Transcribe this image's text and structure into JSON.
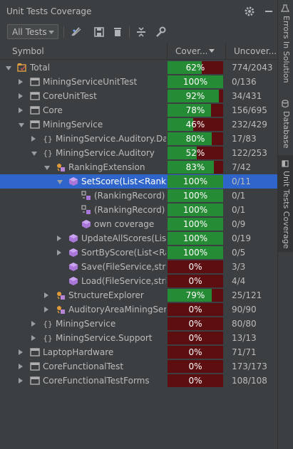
{
  "panel": {
    "title": "Unit Tests Coverage",
    "header_icons": [
      "gear-icon",
      "minimize-icon"
    ]
  },
  "toolbar": {
    "filter_value": "All Tests",
    "icons": [
      "show-covering-tests-icon",
      "export-icon",
      "delete-icon",
      "collapse-all-icon",
      "settings-wrench-icon"
    ]
  },
  "columns": {
    "symbol": "Symbol",
    "coverage": "Cover...",
    "uncovered": "Uncover..."
  },
  "colors": {
    "covered": "#268b35",
    "uncovered": "#5c0e10",
    "selection": "#2f65ca"
  },
  "rows": [
    {
      "label": "Total",
      "coverage": "62%",
      "percent": 62,
      "uncovered": "774/2043",
      "kind": "root",
      "depth": 0,
      "expander": "down"
    },
    {
      "label": "MiningServiceUnitTest",
      "coverage": "100%",
      "percent": 100,
      "uncovered": "0/136",
      "kind": "project",
      "depth": 1,
      "expander": "right"
    },
    {
      "label": "CoreUnitTest",
      "coverage": "92%",
      "percent": 92,
      "uncovered": "34/431",
      "kind": "project",
      "depth": 1,
      "expander": "right"
    },
    {
      "label": "Core",
      "coverage": "78%",
      "percent": 78,
      "uncovered": "156/695",
      "kind": "project",
      "depth": 1,
      "expander": "right"
    },
    {
      "label": "MiningService",
      "coverage": "46%",
      "percent": 46,
      "uncovered": "232/429",
      "kind": "project",
      "depth": 1,
      "expander": "down"
    },
    {
      "label": "MiningService.Auditory.Data",
      "coverage": "80%",
      "percent": 80,
      "uncovered": "17/83",
      "kind": "namespace",
      "depth": 2,
      "expander": "right"
    },
    {
      "label": "MiningService.Auditory",
      "coverage": "52%",
      "percent": 52,
      "uncovered": "122/253",
      "kind": "namespace",
      "depth": 2,
      "expander": "down"
    },
    {
      "label": "RankingExtension",
      "coverage": "83%",
      "percent": 83,
      "uncovered": "7/42",
      "kind": "class",
      "depth": 3,
      "expander": "down"
    },
    {
      "label": "SetScore(List<Ranking",
      "coverage": "100%",
      "percent": 100,
      "uncovered": "0/11",
      "kind": "method",
      "depth": 4,
      "expander": "down",
      "selected": true
    },
    {
      "label": "(RankingRecord)",
      "coverage": "100%",
      "percent": 100,
      "uncovered": "0/1",
      "kind": "lambda",
      "depth": 5,
      "expander": "none"
    },
    {
      "label": "(RankingRecord)",
      "coverage": "100%",
      "percent": 100,
      "uncovered": "0/1",
      "kind": "lambda",
      "depth": 5,
      "expander": "none"
    },
    {
      "label": "own coverage",
      "coverage": "100%",
      "percent": 100,
      "uncovered": "0/9",
      "kind": "method",
      "depth": 5,
      "expander": "none"
    },
    {
      "label": "UpdateAllScores(List<R",
      "coverage": "100%",
      "percent": 100,
      "uncovered": "0/19",
      "kind": "method",
      "depth": 4,
      "expander": "right"
    },
    {
      "label": "SortByScore(List<Rank",
      "coverage": "100%",
      "percent": 100,
      "uncovered": "0/5",
      "kind": "method",
      "depth": 4,
      "expander": "right"
    },
    {
      "label": "Save(FileService,string,",
      "coverage": "0%",
      "percent": 0,
      "uncovered": "3/3",
      "kind": "method",
      "depth": 4,
      "expander": "none"
    },
    {
      "label": "Load(FileService,string",
      "coverage": "0%",
      "percent": 0,
      "uncovered": "4/4",
      "kind": "method",
      "depth": 4,
      "expander": "none"
    },
    {
      "label": "StructureExplorer",
      "coverage": "79%",
      "percent": 79,
      "uncovered": "25/121",
      "kind": "class",
      "depth": 3,
      "expander": "right"
    },
    {
      "label": "AuditoryAreaMiningServic",
      "coverage": "0%",
      "percent": 0,
      "uncovered": "90/90",
      "kind": "class",
      "depth": 3,
      "expander": "right"
    },
    {
      "label": "MiningService",
      "coverage": "0%",
      "percent": 0,
      "uncovered": "80/80",
      "kind": "namespace",
      "depth": 2,
      "expander": "right"
    },
    {
      "label": "MiningService.Support",
      "coverage": "0%",
      "percent": 0,
      "uncovered": "13/13",
      "kind": "namespace",
      "depth": 2,
      "expander": "right"
    },
    {
      "label": "LaptopHardware",
      "coverage": "0%",
      "percent": 0,
      "uncovered": "71/71",
      "kind": "project",
      "depth": 1,
      "expander": "right"
    },
    {
      "label": "CoreFunctionalTest",
      "coverage": "0%",
      "percent": 0,
      "uncovered": "173/173",
      "kind": "project",
      "depth": 1,
      "expander": "right"
    },
    {
      "label": "CoreFunctionalTestForms",
      "coverage": "0%",
      "percent": 0,
      "uncovered": "108/108",
      "kind": "project",
      "depth": 1,
      "expander": "right"
    }
  ],
  "side_tabs": [
    {
      "label": "Errors In Solution",
      "active": false
    },
    {
      "label": "Database",
      "active": false
    },
    {
      "label": "Unit Tests Coverage",
      "active": true
    }
  ]
}
